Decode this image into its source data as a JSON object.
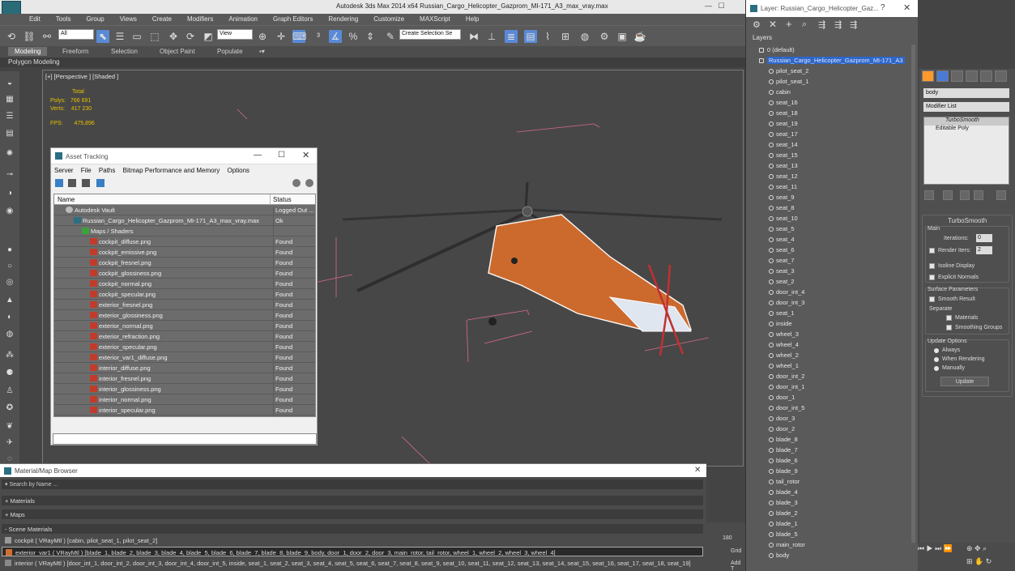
{
  "app": {
    "title": "Autodesk 3ds Max  2014 x64     Russian_Cargo_Helicopter_Gazprom_MI-171_A3_max_vray.max",
    "menu": [
      "Edit",
      "Tools",
      "Group",
      "Views",
      "Create",
      "Modifiers",
      "Animation",
      "Graph Editors",
      "Rendering",
      "Customize",
      "MAXScript",
      "Help"
    ]
  },
  "toolbar": {
    "filter_value": "All",
    "coord_value": "View",
    "selection_set_placeholder": "Create Selection Se"
  },
  "ribbon": {
    "tabs": [
      "Modeling",
      "Freeform",
      "Selection",
      "Object Paint",
      "Populate"
    ],
    "active": "Modeling",
    "sub_label": "Polygon Modeling"
  },
  "viewport": {
    "label": "[+] [Perspective ] [Shaded ]",
    "stats": {
      "total_label": "Total",
      "polys_label": "Polys:",
      "polys_value": "766 691",
      "verts_label": "Verts:",
      "verts_value": "417 230",
      "fps_label": "FPS:",
      "fps_value": "475,896"
    }
  },
  "asset_tracking": {
    "title": "Asset Tracking",
    "menu": [
      "Server",
      "File",
      "Paths",
      "Bitmap Performance and Memory",
      "Options"
    ],
    "columns": {
      "name": "Name",
      "status": "Status"
    },
    "rows": [
      {
        "name": "Autodesk Vault",
        "status": "Logged Out ...",
        "indent": 1,
        "kind": "vault"
      },
      {
        "name": "Russian_Cargo_Helicopter_Gazprom_MI-171_A3_max_vray.max",
        "status": "Ok",
        "indent": 2,
        "kind": "max"
      },
      {
        "name": "Maps / Shaders",
        "status": "",
        "indent": 3,
        "kind": "folder"
      },
      {
        "name": "cockpit_diffuse.png",
        "status": "Found",
        "indent": 4,
        "kind": "png"
      },
      {
        "name": "cockpit_emissive.png",
        "status": "Found",
        "indent": 4,
        "kind": "png"
      },
      {
        "name": "cockpit_fresnel.png",
        "status": "Found",
        "indent": 4,
        "kind": "png"
      },
      {
        "name": "cockpit_glossiness.png",
        "status": "Found",
        "indent": 4,
        "kind": "png"
      },
      {
        "name": "cockpit_normal.png",
        "status": "Found",
        "indent": 4,
        "kind": "png"
      },
      {
        "name": "cockpit_specular.png",
        "status": "Found",
        "indent": 4,
        "kind": "png"
      },
      {
        "name": "exterior_fresnel.png",
        "status": "Found",
        "indent": 4,
        "kind": "png"
      },
      {
        "name": "exterior_glossiness.png",
        "status": "Found",
        "indent": 4,
        "kind": "png"
      },
      {
        "name": "exterior_normal.png",
        "status": "Found",
        "indent": 4,
        "kind": "png"
      },
      {
        "name": "exterior_refraction.png",
        "status": "Found",
        "indent": 4,
        "kind": "png"
      },
      {
        "name": "exterior_specular.png",
        "status": "Found",
        "indent": 4,
        "kind": "png"
      },
      {
        "name": "exterior_var1_diffuse.png",
        "status": "Found",
        "indent": 4,
        "kind": "png"
      },
      {
        "name": "interior_diffuse.png",
        "status": "Found",
        "indent": 4,
        "kind": "png"
      },
      {
        "name": "interior_fresnel.png",
        "status": "Found",
        "indent": 4,
        "kind": "png"
      },
      {
        "name": "interior_glossiness.png",
        "status": "Found",
        "indent": 4,
        "kind": "png"
      },
      {
        "name": "interior_normal.png",
        "status": "Found",
        "indent": 4,
        "kind": "png"
      },
      {
        "name": "interior_specular.png",
        "status": "Found",
        "indent": 4,
        "kind": "png"
      }
    ]
  },
  "layer_explorer": {
    "title": "Layer: Russian_Cargo_Helicopter_Gaz...",
    "header": "Layers",
    "layers": [
      "0 (default)",
      "Russian_Cargo_Helicopter_Gazprom_MI-171_A3"
    ],
    "objects": [
      "pilot_seat_2",
      "pilot_seat_1",
      "cabin",
      "seat_16",
      "seat_18",
      "seat_19",
      "seat_17",
      "seat_14",
      "seat_15",
      "seat_13",
      "seat_12",
      "seat_11",
      "seat_9",
      "seat_8",
      "seat_10",
      "seat_5",
      "seat_4",
      "seat_6",
      "seat_7",
      "seat_3",
      "seat_2",
      "door_int_4",
      "door_int_3",
      "seat_1",
      "inside",
      "wheel_3",
      "wheel_4",
      "wheel_2",
      "wheel_1",
      "door_int_2",
      "door_int_1",
      "door_1",
      "door_int_5",
      "door_3",
      "door_2",
      "blade_8",
      "blade_7",
      "blade_6",
      "blade_9",
      "tail_rotor",
      "blade_4",
      "blade_3",
      "blade_2",
      "blade_1",
      "blade_5",
      "main_rotor",
      "body"
    ]
  },
  "command_panel": {
    "object_name": "body",
    "modifier_list": "Modifier List",
    "stack": [
      "TurboSmooth",
      "Editable Poly"
    ],
    "rollout_title": "TurboSmooth",
    "main_label": "Main",
    "iterations_label": "Iterations:",
    "iterations_value": "0",
    "render_iters_label": "Render Iters:",
    "render_iters_value": "2",
    "isoline_label": "Isoline Display",
    "explicit_normals_label": "Explicit Normals",
    "surface_label": "Surface Parameters",
    "smooth_result_label": "Smooth Result",
    "separate_label": "Separate",
    "materials_label": "Materials",
    "smoothing_groups_label": "Smoothing Groups",
    "update_options_label": "Update Options",
    "always_label": "Always",
    "when_rendering_label": "When Rendering",
    "manually_label": "Manually",
    "update_button": "Update"
  },
  "material_browser": {
    "title": "Material/Map Browser",
    "search_placeholder": "Search by Name ...",
    "sections": [
      "+ Materials",
      "+ Maps",
      "- Scene Materials"
    ],
    "materials": [
      "cockpit  ( VRayMtl )  [cabin, pilot_seat_1, pilot_seat_2]",
      "exterior_var1  ( VRayMtl )  [blade_1, blade_2, blade_3, blade_4, blade_5, blade_6, blade_7, blade_8, blade_9, body, door_1, door_2, door_3, main_rotor, tail_rotor, wheel_1, wheel_2, wheel_3, wheel_4]",
      "interior  ( VRayMtl )  [door_int_1, door_int_2, door_int_3, door_int_4, door_int_5, inside, seat_1, seat_2, seat_3, seat_4, seat_5, seat_6, seat_7, seat_8, seat_9, seat_10, seat_11, seat_12, seat_13, seat_14, seat_15, seat_16, seat_17, seat_18, seat_19]"
    ]
  },
  "timeline": {
    "frame_label": "180",
    "grid_label": "Grid",
    "add_label": "Add T"
  }
}
